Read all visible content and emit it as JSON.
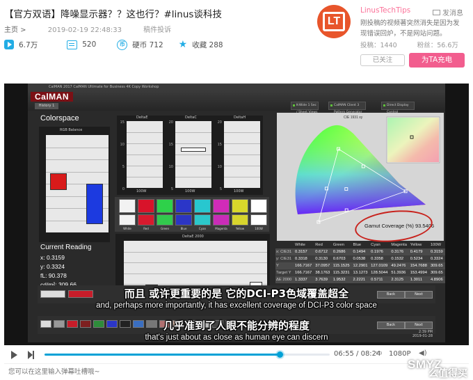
{
  "video": {
    "title": "【官方双语】降噪显示器？？这也行？#linus谈科技",
    "breadcrumb": "主页 >",
    "date": "2019-02-19 22:48:33",
    "report": "稿件投诉",
    "stats": {
      "views": "6.7万",
      "danmaku": "520",
      "coins_label": "硬币 712",
      "favorites_label": "收藏 288"
    }
  },
  "uploader": {
    "name": "LinusTechTips",
    "message_label": "发消息",
    "sign": "刚投稿的视频著突然消失是因为发现错误回炉，不是网站问题。",
    "submissions": "投稿：1440",
    "fans": "粉丝：56.6万",
    "followed_label": "已关注",
    "charge_label": "为TA充电"
  },
  "calman": {
    "window_bar": "CalMAN 2017 CalMAN Ultimate for Business 4K Copy Workshop",
    "logo": "CalMAN",
    "history": "History 1",
    "toolbar_pills": [
      "K-Wide 1 Sec / Sheet Views",
      "CalMAN Client 3 Pattern Generator",
      "Direct Display Control"
    ],
    "colorspace_title": "Colorspace",
    "rgb_balance": "RGB Balance",
    "delta_e_labels": [
      "DeltaE",
      "DeltaC",
      "DeltaH"
    ],
    "delta_e_bottom": "100W",
    "delta_e_2000": "DeltaE 2000",
    "ticks_15": [
      "15",
      "10",
      "5",
      "0"
    ],
    "ticks_20": [
      "20",
      "15",
      "10",
      "5"
    ],
    "swatch_labels": [
      "White",
      "Red",
      "Green",
      "Blue",
      "Cyan",
      "Magenta",
      "Yellow",
      "100W"
    ],
    "swatch_colors": [
      "#f2f2f2",
      "#d8132a",
      "#2ed14a",
      "#2b36c8",
      "#28c7cf",
      "#d12bb8",
      "#d9d72b",
      "#ffffff"
    ],
    "swatch_colors_target": [
      "#f2f2f2",
      "#d81a2e",
      "#32c94d",
      "#2c35c2",
      "#2cc7ca",
      "#c92cb7",
      "#d7d42d",
      "#ffffff"
    ],
    "current_reading_title": "Current Reading",
    "current_reading": [
      "x: 0.3159",
      "y: 0.3324",
      "fL: 90.378",
      "cd/m²: 309.66"
    ],
    "cie_label": "CIE 1931 xy",
    "gamut_coverage": "Gamut Coverage (%) 93.5406",
    "table_header": [
      "",
      "White",
      "Red",
      "Green",
      "Blue",
      "Cyan",
      "Magenta",
      "Yellow",
      "100W"
    ],
    "table_rows": [
      [
        "x: CIE31",
        "0.3157",
        "0.6712",
        "0.2686",
        "0.1494",
        "0.1976",
        "0.3176",
        "0.4179",
        "0.3159"
      ],
      [
        "y: CIE31",
        "0.3318",
        "0.3130",
        "0.6703",
        "0.0538",
        "0.3358",
        "0.1532",
        "0.5234",
        "0.3324"
      ],
      [
        "Y",
        "166.7167",
        "37.0957",
        "115.1525",
        "12.2901",
        "127.0109",
        "49.2476",
        "154.7688",
        "309.65"
      ],
      [
        "Target Y",
        "166.7167",
        "38.1763",
        "115.3231",
        "13.1273",
        "128.5044",
        "51.3936",
        "153.4994",
        "309.65"
      ],
      [
        "ΔE 2000",
        "1.3337",
        "3.7639",
        "1.9532",
        "2.2221",
        "0.5711",
        "2.3125",
        "1.3011",
        "4.8906"
      ]
    ],
    "step_buttons": [
      "Back",
      "Next"
    ],
    "clock": [
      "2:39 PM",
      "2019-01-28"
    ]
  },
  "subtitles": {
    "line1_cn": "而且 或许更重要的是 它的DCI-P3色域覆盖超全",
    "line1_en": "and, perhaps more importantly, it has excellent coverage of DCI-P3 color space",
    "line2_cn": "几乎准到了人眼不能分辨的程度",
    "line2_en": "that's just about as close as human eye can discern"
  },
  "player": {
    "current_time": "06:55",
    "duration": "08:24",
    "progress_fraction": 0.824,
    "resolution": "1080P",
    "danmaku_placeholder": "您可以在这里输入弹幕吐槽哦~"
  },
  "watermark": {
    "text": "SMYZ",
    "text2": "么值得买"
  },
  "chart_data": [
    {
      "type": "bar",
      "title": "RGB Balance",
      "series": [
        {
          "name": "",
          "values": [
            107,
            88
          ]
        }
      ],
      "ylim": [
        0,
        200
      ]
    },
    {
      "type": "bar",
      "title": "DeltaE 2000",
      "categories": [
        "White",
        "Red",
        "Green",
        "Blue",
        "Cyan",
        "Magenta",
        "Yellow",
        "100W"
      ],
      "values": [
        1.33,
        3.76,
        1.95,
        2.22,
        0.57,
        2.31,
        1.3,
        4.89
      ],
      "ylim": [
        0,
        20
      ]
    },
    {
      "type": "scatter",
      "title": "CIE 1931 xy",
      "x": [
        0.3157,
        0.6712,
        0.2686,
        0.1494,
        0.1976,
        0.3176,
        0.4179
      ],
      "y": [
        0.3318,
        0.313,
        0.6703,
        0.0538,
        0.3358,
        0.1532,
        0.5234
      ],
      "xlim": [
        0,
        0.8
      ],
      "ylim": [
        0,
        0.9
      ]
    }
  ],
  "colors": {
    "accent_pink": "#f25d8e",
    "accent_blue": "#00a1d6",
    "calman_red": "#7b1015"
  }
}
